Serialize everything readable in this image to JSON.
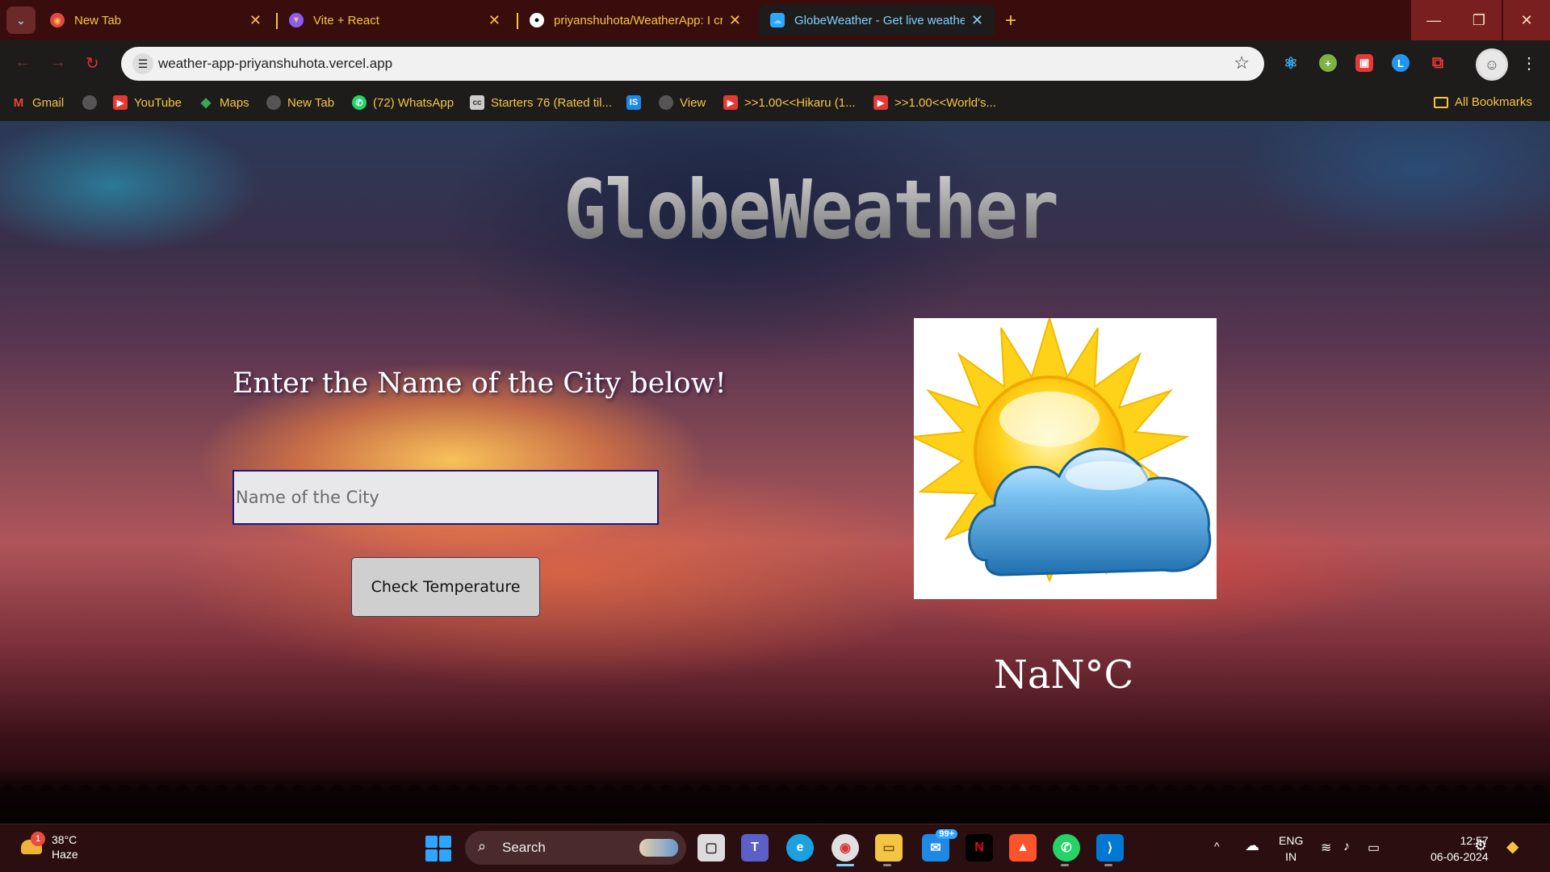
{
  "browser": {
    "tabs": [
      {
        "title": "New Tab",
        "favicon": "chrome-icon",
        "active": false
      },
      {
        "title": "Vite + React",
        "favicon": "vite-icon",
        "active": false
      },
      {
        "title": "priyanshuhota/WeatherApp: I cr",
        "favicon": "github-icon",
        "active": false
      },
      {
        "title": "GlobeWeather - Get live weathe",
        "favicon": "globeweather-icon",
        "active": true
      }
    ],
    "address": "weather-app-priyanshuhota.vercel.app",
    "bookmarks": [
      {
        "label": "Gmail",
        "icon": "gmail-icon"
      },
      {
        "label": "",
        "icon": "globe-icon"
      },
      {
        "label": "YouTube",
        "icon": "youtube-icon"
      },
      {
        "label": "Maps",
        "icon": "maps-icon"
      },
      {
        "label": "New Tab",
        "icon": "globe-icon"
      },
      {
        "label": "(72) WhatsApp",
        "icon": "whatsapp-icon"
      },
      {
        "label": "Starters 76 (Rated til...",
        "icon": "codechef-icon"
      },
      {
        "label": "",
        "icon": "is-icon"
      },
      {
        "label": "View",
        "icon": "globe-icon"
      },
      {
        "label": ">>1.00<<Hikaru (1...",
        "icon": "youtube-icon"
      },
      {
        "label": ">>1.00<<World's...",
        "icon": "youtube-icon"
      }
    ],
    "all_bookmarks": "All Bookmarks"
  },
  "app": {
    "title": "GlobeWeather",
    "prompt": "Enter the Name of the City below!",
    "city_input": {
      "placeholder": "Name of the City",
      "value": ""
    },
    "button_label": "Check Temperature",
    "weather_icon": "sun-behind-cloud-icon",
    "temperature": "NaN°C"
  },
  "taskbar": {
    "weather": {
      "temp": "38°C",
      "condition": "Haze",
      "badge": "1"
    },
    "search_label": "Search",
    "mail_badge": "99+",
    "language": {
      "line1": "ENG",
      "line2": "IN"
    },
    "time": "12:57",
    "date": "06-06-2024"
  },
  "colors": {
    "tab_text": "#f5c542",
    "active_tab_text": "#7fd3ff",
    "chrome_bg": "#1e1b1b",
    "taskbar_bg": "#2b0f10"
  }
}
